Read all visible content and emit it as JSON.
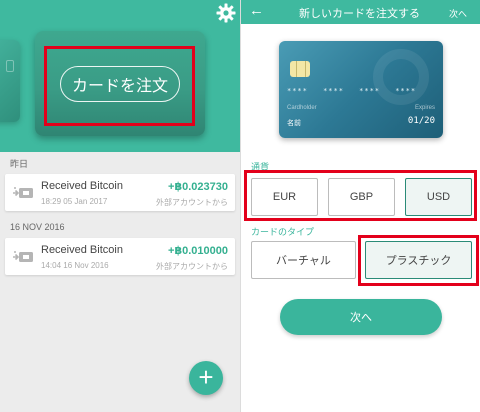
{
  "left_panel": {
    "order_card_button": "カードを注文",
    "sections": [
      {
        "label": "昨日",
        "transaction": {
          "title": "Received Bitcoin",
          "time": "18:29 05 Jan 2017",
          "amount": "+฿0.023730",
          "destination": "外部アカウントから"
        }
      },
      {
        "label": "16 NOV 2016",
        "transaction": {
          "title": "Received Bitcoin",
          "time": "14:04 16 Nov 2016",
          "amount": "+฿0.010000",
          "destination": "外部アカウントから"
        }
      }
    ],
    "fab_label": "+"
  },
  "right_panel": {
    "header": {
      "back_glyph": "←",
      "title": "新しいカードを注文する",
      "next_label": "次へ"
    },
    "card_preview": {
      "number": "**** **** **** ****",
      "holder_label": "Cardholder",
      "expires_label": "Expires",
      "holder_name": "名前",
      "expiry": "01/20"
    },
    "currency": {
      "label": "通貨",
      "options": [
        "EUR",
        "GBP",
        "USD"
      ],
      "selected": "USD"
    },
    "card_type": {
      "label": "カードのタイプ",
      "options": [
        "バーチャル",
        "プラスチック"
      ],
      "selected": "プラスチック"
    },
    "next_button": "次へ"
  },
  "colors": {
    "accent": "#3ab59c",
    "highlight_box": "#e3001b",
    "card_blue": "#2d7995"
  },
  "icons": {
    "settings": "gear-icon",
    "back": "arrow-left-icon",
    "receive": "receive-icon",
    "fab": "plus-icon"
  }
}
